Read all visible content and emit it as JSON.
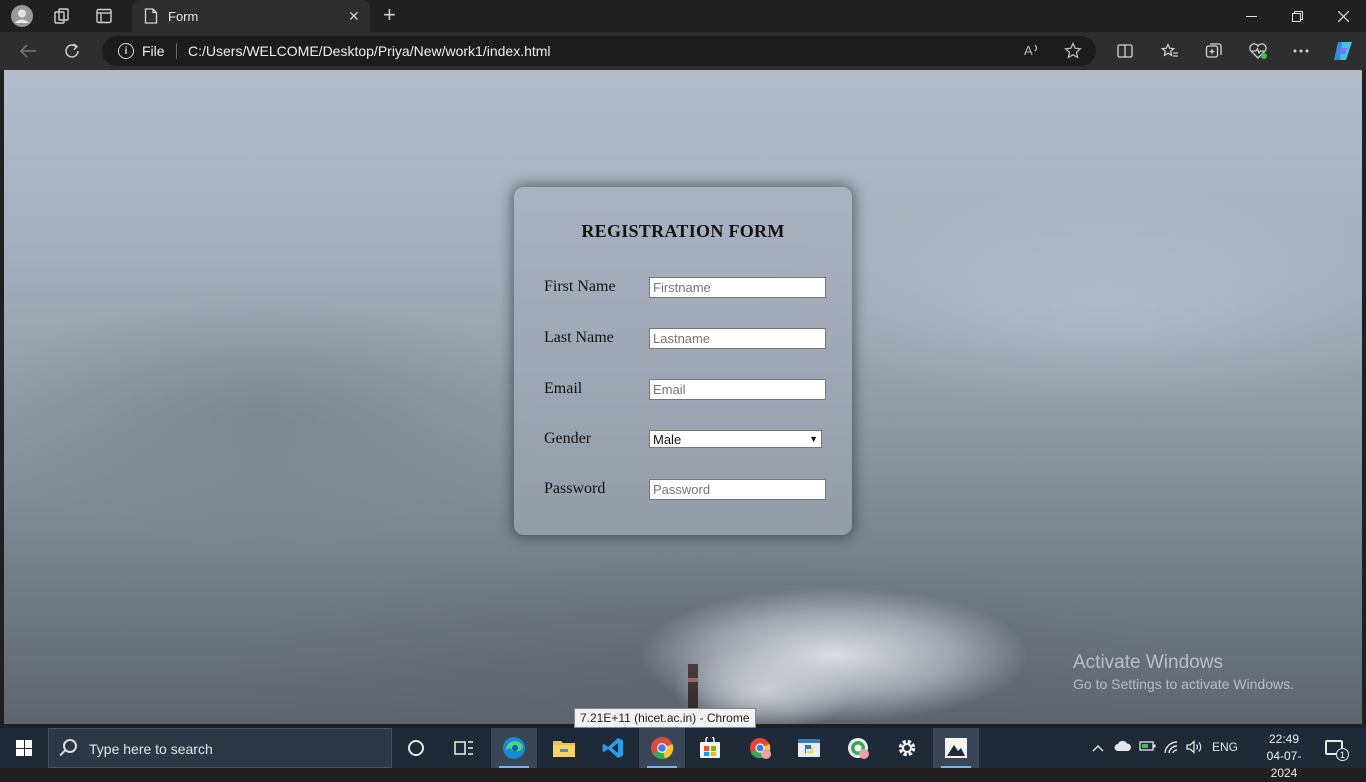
{
  "browser": {
    "tab_title": "Form",
    "tab_close": "✕",
    "new_tab": "+",
    "address_scheme": "File",
    "address_url": "C:/Users/WELCOME/Desktop/Priya/New/work1/index.html"
  },
  "form": {
    "title": "REGISTRATION FORM",
    "first_name_label": "First Name",
    "first_name_placeholder": "Firstname",
    "last_name_label": "Last Name",
    "last_name_placeholder": "Lastname",
    "email_label": "Email",
    "email_placeholder": "Email",
    "gender_label": "Gender",
    "gender_selected": "Male",
    "password_label": "Password",
    "password_placeholder": "Password"
  },
  "watermark": {
    "line1": "Activate Windows",
    "line2": "Go to Settings to activate Windows."
  },
  "tooltip": "7.21E+11 (hicet.ac.in) - Chrome",
  "taskbar": {
    "search_placeholder": "Type here to search",
    "language": "ENG",
    "time": "22:49",
    "date": "04-07-2024",
    "notification_count": "1"
  },
  "colors": {
    "taskbar_bg": "#1f2a38",
    "browser_bg": "#202020",
    "card_bg": "#a8b0c0"
  }
}
